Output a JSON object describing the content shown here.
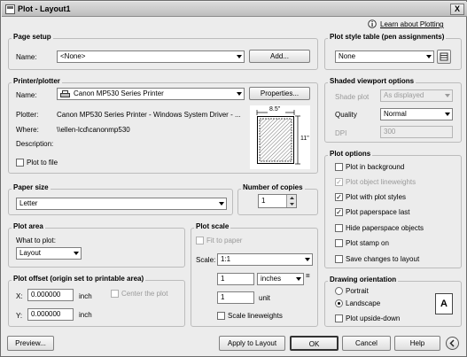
{
  "window": {
    "title": "Plot - Layout1",
    "close_glyph": "X"
  },
  "help_link": "Learn about Plotting",
  "page_setup": {
    "label": "Page setup",
    "name_label": "Name:",
    "name_value": "<None>",
    "add_button": "Add..."
  },
  "printer": {
    "label": "Printer/plotter",
    "name_label": "Name:",
    "name_value": "Canon MP530 Series Printer",
    "properties_button": "Properties...",
    "plotter_label": "Plotter:",
    "plotter_value": "Canon MP530 Series Printer - Windows System Driver - ...",
    "where_label": "Where:",
    "where_value": "\\\\ellen-lcd\\canonmp530",
    "description_label": "Description:",
    "plot_to_file": "Plot to file",
    "preview_width": "8.5\"",
    "preview_height": "11\""
  },
  "paper_size": {
    "label": "Paper size",
    "value": "Letter"
  },
  "copies": {
    "label": "Number of copies",
    "value": "1"
  },
  "plot_area": {
    "label": "Plot area",
    "what_label": "What to plot:",
    "what_value": "Layout"
  },
  "plot_scale": {
    "label": "Plot scale",
    "fit_to_paper": "Fit to paper",
    "scale_label": "Scale:",
    "scale_value": "1:1",
    "value1": "1",
    "units": "inches",
    "equals": "=",
    "value2": "1",
    "unit_label": "unit",
    "scale_lineweights": "Scale lineweights"
  },
  "plot_offset": {
    "label": "Plot offset (origin set to printable area)",
    "x_label": "X:",
    "x_value": "0.000000",
    "x_unit": "inch",
    "y_label": "Y:",
    "y_value": "0.000000",
    "y_unit": "inch",
    "center": "Center the plot"
  },
  "plot_style_table": {
    "label": "Plot style table (pen assignments)",
    "value": "None"
  },
  "shaded_viewport": {
    "label": "Shaded viewport options",
    "shade_label": "Shade plot",
    "shade_value": "As displayed",
    "quality_label": "Quality",
    "quality_value": "Normal",
    "dpi_label": "DPI",
    "dpi_value": "300"
  },
  "plot_options": {
    "label": "Plot options",
    "items": [
      {
        "label": "Plot in background",
        "checked": false,
        "disabled": false
      },
      {
        "label": "Plot object lineweights",
        "checked": true,
        "disabled": true
      },
      {
        "label": "Plot with plot styles",
        "checked": true,
        "disabled": false
      },
      {
        "label": "Plot paperspace last",
        "checked": true,
        "disabled": false
      },
      {
        "label": "Hide paperspace objects",
        "checked": false,
        "disabled": false
      },
      {
        "label": "Plot stamp on",
        "checked": false,
        "disabled": false
      },
      {
        "label": "Save changes to layout",
        "checked": false,
        "disabled": false
      }
    ]
  },
  "orientation": {
    "label": "Drawing orientation",
    "portrait": "Portrait",
    "landscape": "Landscape",
    "upside_down": "Plot upside-down",
    "icon_letter": "A"
  },
  "buttons": {
    "preview": "Preview...",
    "apply": "Apply to Layout",
    "ok": "OK",
    "cancel": "Cancel",
    "help": "Help"
  }
}
